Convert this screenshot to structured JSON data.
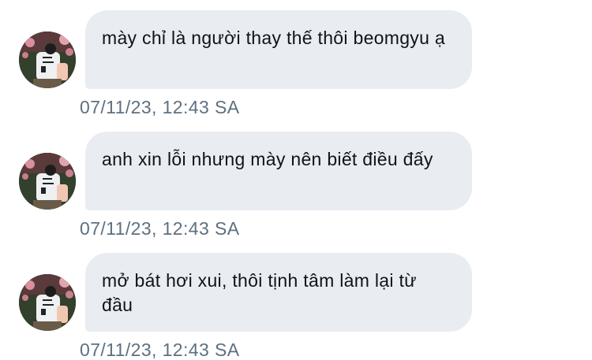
{
  "conversation": {
    "messages": [
      {
        "text": "mày chỉ là người thay thế thôi beomgyu ạ",
        "timestamp": "07/11/23, 12:43 SA",
        "avatar_icon": "user-avatar-photo"
      },
      {
        "text": "anh xin lỗi nhưng mày nên biết điều đấy",
        "timestamp": "07/11/23, 12:43 SA",
        "avatar_icon": "user-avatar-photo"
      },
      {
        "text": "mở bát hơi xui, thôi tịnh tâm làm lại từ đầu",
        "timestamp": "07/11/23, 12:43 SA",
        "avatar_icon": "user-avatar-photo"
      }
    ]
  },
  "colors": {
    "bubble_background": "#e9edf1",
    "message_text": "#0f1419",
    "timestamp_text": "#5d7080"
  }
}
